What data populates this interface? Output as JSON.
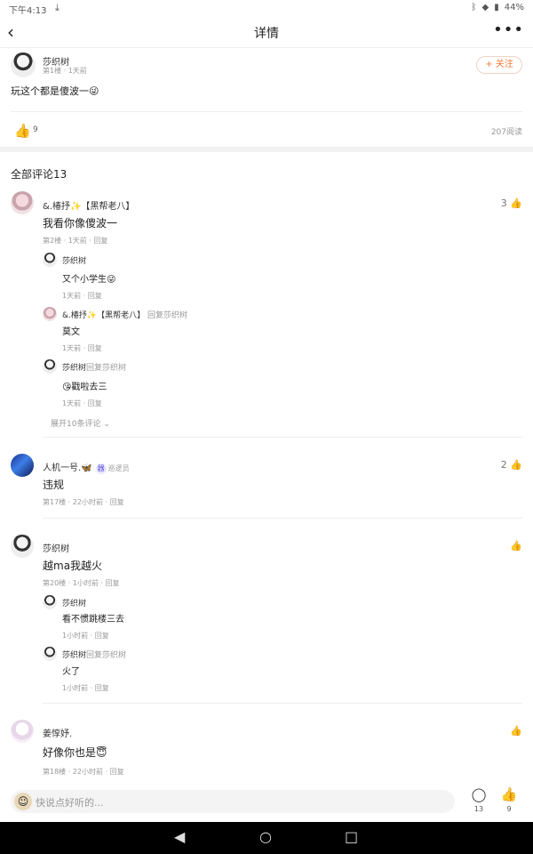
{
  "status": {
    "time": "下午4:13",
    "battery": "44%"
  },
  "header": {
    "title": "详情"
  },
  "post": {
    "author": "莎织树",
    "meta": "第1楼 · 1天前",
    "follow_label": "+ 关注",
    "text": "玩这个都是傻波一😜",
    "likes": "9",
    "reads": "207阅读"
  },
  "comments_heading": "全部评论13",
  "comments": [
    {
      "name": "&.椿抒✨【黑帮老八】",
      "text": "我看你像傻波一",
      "meta": "第2楼 · 1天前 · 回复",
      "likes": "3",
      "replies": [
        {
          "name": "莎织树",
          "text": "又个小学生😜",
          "meta": "1天前 · 回复"
        },
        {
          "name": "&.椿抒✨【黑帮老八】",
          "reply_to": "回复莎织树",
          "text": "莫文",
          "meta": "1天前 · 回复"
        },
        {
          "name": "莎织树",
          "reply_to": "回复莎织树",
          "text": "😘戳啦去三",
          "meta": "1天前 · 回复"
        }
      ],
      "expand": "展开10条评论 ⌄"
    },
    {
      "name": "人机一号.🦋",
      "badge": "器",
      "badge_label": "巡逻员",
      "text": "违规",
      "meta": "第17楼 · 22小时前 · 回复",
      "likes": "2"
    },
    {
      "name": "莎织树",
      "text": "越ma我越火",
      "meta": "第20楼 · 1小时前 · 回复",
      "replies": [
        {
          "name": "莎织树",
          "text": "看不惯跳楼三去",
          "meta": "1小时前 · 回复"
        },
        {
          "name": "莎织树",
          "reply_to": "回复莎织树",
          "text": "火了",
          "meta": "1小时前 · 回复"
        }
      ]
    },
    {
      "name": "姜惇妤.",
      "text": "好像你也是😇",
      "meta": "第18楼 · 22小时前 · 回复"
    }
  ],
  "bottom": {
    "placeholder": "快说点好听的...",
    "comment_count": "13",
    "like_count": "9"
  }
}
